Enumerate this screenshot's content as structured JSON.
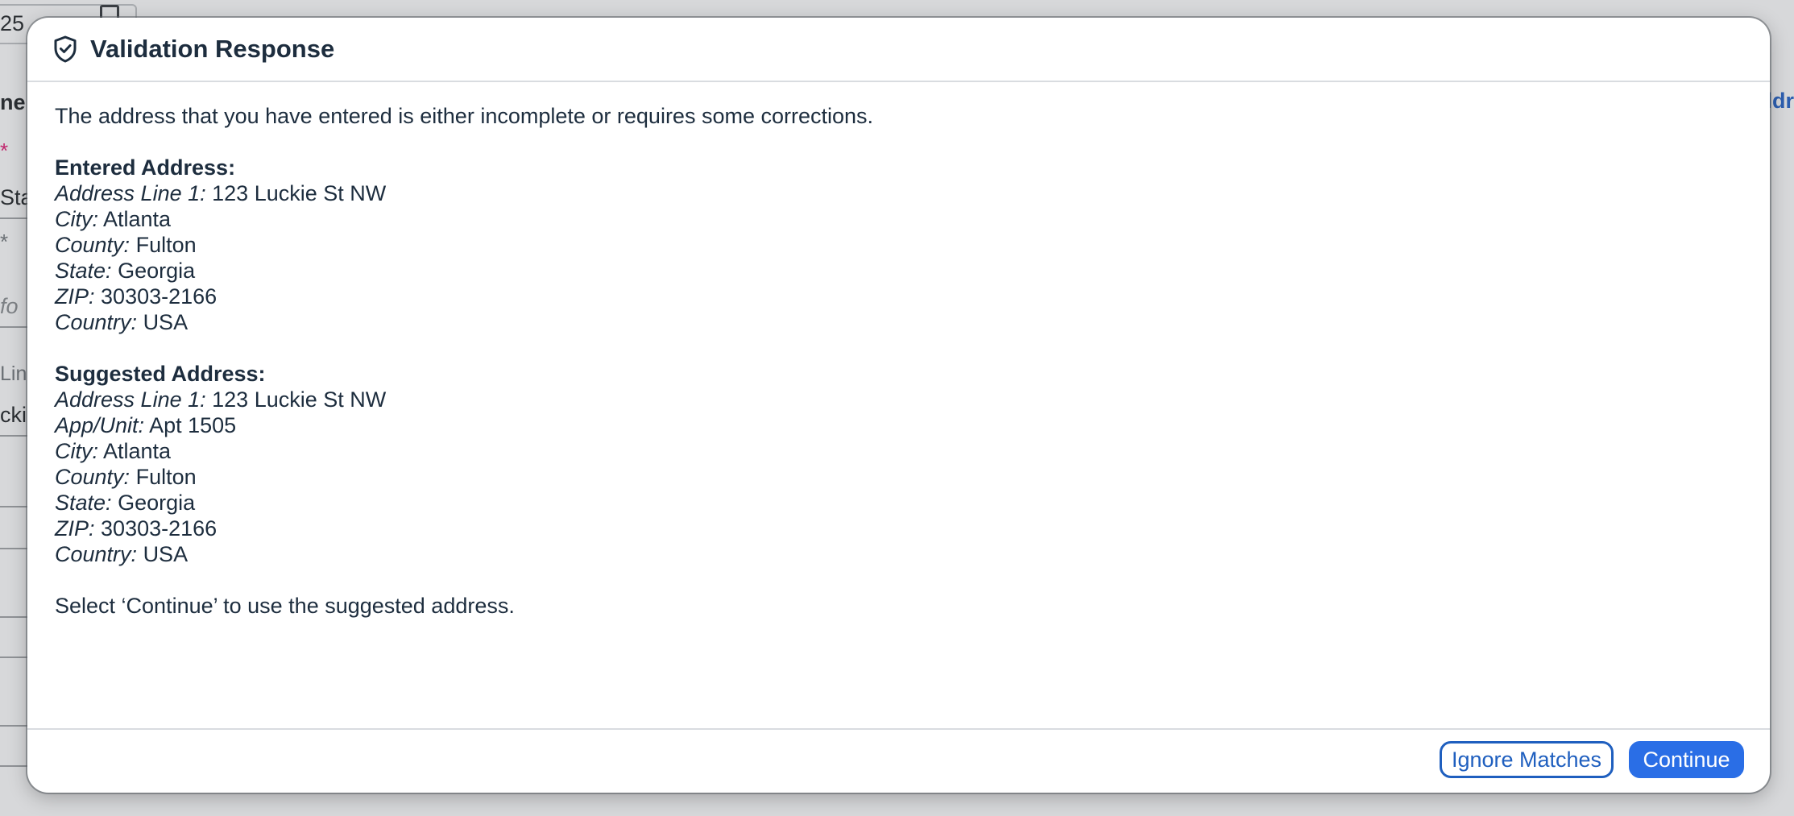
{
  "background": {
    "date_fragment": "25",
    "label_fragment_1": "ne",
    "required_mark": "*",
    "field_fragment_1": "Sta",
    "placeholder_fragment": "fo",
    "label_fragment_2": "Lin",
    "field_fragment_2": "ckie",
    "link_fragment": "ldr"
  },
  "dialog": {
    "title": "Validation Response",
    "icon": "shield-check-icon",
    "intro": "The address that you have entered is either incomplete or requires some corrections.",
    "entered": {
      "heading": "Entered Address:",
      "rows": [
        {
          "label": "Address Line 1:",
          "value": "123 Luckie St NW"
        },
        {
          "label": "City:",
          "value": "Atlanta"
        },
        {
          "label": "County:",
          "value": "Fulton"
        },
        {
          "label": "State:",
          "value": "Georgia"
        },
        {
          "label": "ZIP:",
          "value": "30303-2166"
        },
        {
          "label": "Country:",
          "value": "USA"
        }
      ]
    },
    "suggested": {
      "heading": "Suggested Address:",
      "rows": [
        {
          "label": "Address Line 1:",
          "value": "123 Luckie St NW"
        },
        {
          "label": "App/Unit:",
          "value": "Apt 1505"
        },
        {
          "label": "City:",
          "value": "Atlanta"
        },
        {
          "label": "County:",
          "value": "Fulton"
        },
        {
          "label": "State:",
          "value": "Georgia"
        },
        {
          "label": "ZIP:",
          "value": "30303-2166"
        },
        {
          "label": "Country:",
          "value": "USA"
        }
      ]
    },
    "instruction": "Select ‘Continue’ to use the suggested address.",
    "buttons": {
      "ignore_label": "Ignore Matches",
      "continue_label": "Continue"
    }
  },
  "colors": {
    "primary": "#2a6ee6",
    "link": "#1f5fbf",
    "text": "#1d2d3e",
    "overlay": "#c4c6c9"
  }
}
